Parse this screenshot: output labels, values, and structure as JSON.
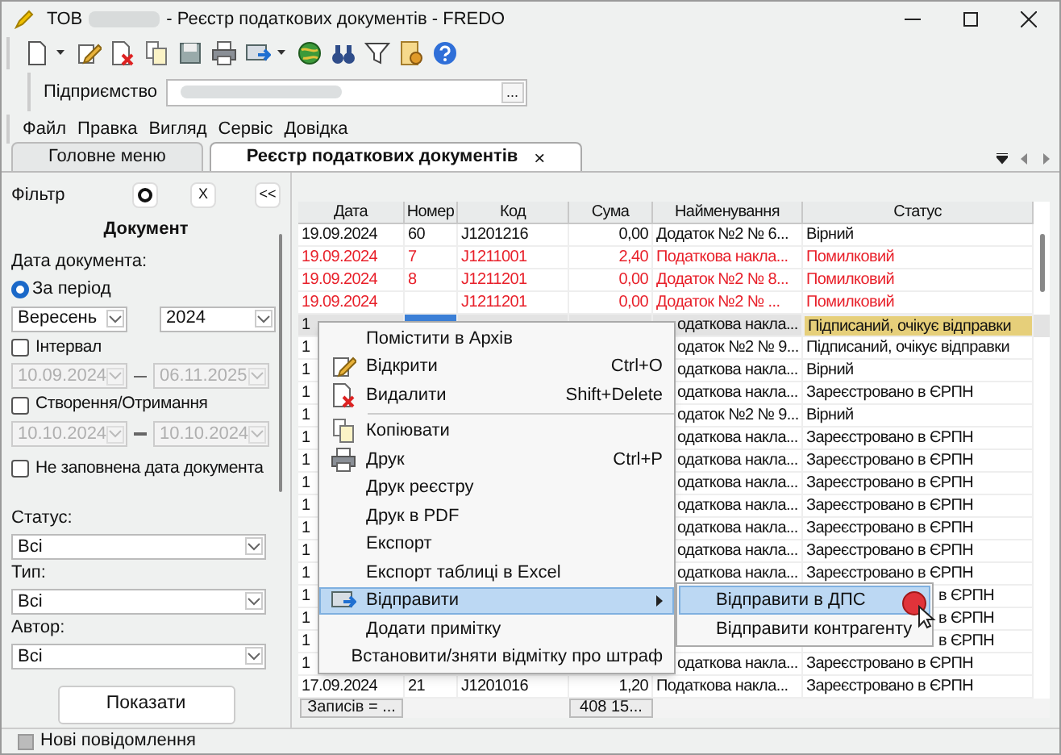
{
  "window": {
    "title_prefix": "ТОВ",
    "title": "- Реєстр податкових документів - FREDO"
  },
  "enterprise": {
    "label": "Підприємство",
    "browse": "..."
  },
  "menu_bar": [
    "Файл",
    "Правка",
    "Вигляд",
    "Сервіс",
    "Довідка"
  ],
  "tabs": [
    {
      "label": "Головне меню",
      "selected": false
    },
    {
      "label": "Реєстр податкових документів",
      "selected": true,
      "close": "×"
    }
  ],
  "filter": {
    "title": "Фільтр",
    "clear": "X",
    "collapse": "<<",
    "section": "Документ",
    "date_label": "Дата документа:",
    "period": {
      "label": "За період",
      "selected": true,
      "month": "Вересень",
      "year": "2024"
    },
    "interval": {
      "label": "Інтервал",
      "checked": false,
      "from": "10.09.2024",
      "to": "06.11.2025",
      "disabled": true
    },
    "created": {
      "label": "Створення/Отримання",
      "checked": false,
      "from": "10.10.2024",
      "to": "10.10.2024",
      "disabled": true
    },
    "empty_date": {
      "label": "Не заповнена дата документа",
      "checked": false
    },
    "selects": [
      {
        "label": "Статус:",
        "value": "Всі"
      },
      {
        "label": "Тип:",
        "value": "Всі"
      },
      {
        "label": "Автор:",
        "value": "Всі"
      }
    ],
    "show_button": "Показати"
  },
  "table": {
    "columns": [
      "Дата",
      "Номер",
      "Код",
      "Сума",
      "Найменування",
      "Статус"
    ],
    "rows": [
      {
        "kind": "normal",
        "selected": false,
        "date": "19.09.2024",
        "number": "60",
        "code": "J1201216",
        "sum": "0,00",
        "name": "Додаток №2 № 6...",
        "status": "Вірний"
      },
      {
        "kind": "error",
        "selected": false,
        "date": "19.09.2024",
        "number": "7",
        "code": "J1211001",
        "sum": "2,40",
        "name": "Податкова накла...",
        "status": "Помилковий"
      },
      {
        "kind": "error",
        "selected": false,
        "date": "19.09.2024",
        "number": "8",
        "code": "J1211201",
        "sum": "0,00",
        "name": "Додаток №2 № 8...",
        "status": "Помилковий"
      },
      {
        "kind": "error",
        "selected": false,
        "date": "19.09.2024",
        "number": "",
        "code": "J1211201",
        "sum": "0,00",
        "name": "Додаток №2 №   ...",
        "status": "Помилковий"
      },
      {
        "kind": "under_menu",
        "selected": true,
        "date": "1",
        "name": "одаткова накла...",
        "status": "Підписаний, очікує відправки"
      },
      {
        "kind": "under_menu",
        "selected": false,
        "date": "1",
        "name": "одаток №2 № 9...",
        "status": "Підписаний, очікує відправки"
      },
      {
        "kind": "under_menu",
        "selected": false,
        "date": "1",
        "name": "одаткова накла...",
        "status": "Вірний"
      },
      {
        "kind": "under_menu",
        "selected": false,
        "date": "1",
        "name": "одаткова накла...",
        "status": "Зареєстровано в ЄРПН"
      },
      {
        "kind": "under_menu",
        "selected": false,
        "date": "1",
        "name": "одаток №2 № 9...",
        "status": "Вірний"
      },
      {
        "kind": "under_menu",
        "selected": false,
        "date": "1",
        "name": "одаткова накла...",
        "status": "Зареєстровано в ЄРПН"
      },
      {
        "kind": "under_menu",
        "selected": false,
        "date": "1",
        "name": "одаткова накла...",
        "status": "Зареєстровано в ЄРПН"
      },
      {
        "kind": "under_menu",
        "selected": false,
        "date": "1",
        "name": "одаткова накла...",
        "status": "Зареєстровано в ЄРПН"
      },
      {
        "kind": "under_menu",
        "selected": false,
        "date": "1",
        "name": "одаткова накла...",
        "status": "Зареєстровано в ЄРПН"
      },
      {
        "kind": "under_menu",
        "selected": false,
        "date": "1",
        "name": "одаткова накла...",
        "status": "Зареєстровано в ЄРПН"
      },
      {
        "kind": "under_menu",
        "selected": false,
        "date": "1",
        "name": "одаткова накла...",
        "status": "Зареєстровано в ЄРПН"
      },
      {
        "kind": "under_menu",
        "selected": false,
        "date": "1",
        "name": "одаткова накла...",
        "status": "Зареєстровано в ЄРПН"
      },
      {
        "kind": "under_submenu",
        "selected": false,
        "date": "1",
        "status": "в ЄРПН"
      },
      {
        "kind": "under_submenu",
        "selected": false,
        "date": "1",
        "status": "в ЄРПН"
      },
      {
        "kind": "under_submenu",
        "selected": false,
        "date": "1",
        "status": "в ЄРПН"
      },
      {
        "kind": "under_menu",
        "selected": false,
        "date": "1",
        "name": "одаткова накла...",
        "status": "Зареєстровано в ЄРПН"
      },
      {
        "kind": "normal",
        "selected": false,
        "date": "17.09.2024",
        "number": "21",
        "code": "J1201016",
        "sum": "1,20",
        "name": "Податкова накла...",
        "status": "Зареєстровано в ЄРПН"
      }
    ],
    "footer": {
      "count": "Записів = ...",
      "total": "408 15..."
    }
  },
  "context_menu": [
    {
      "kind": "item",
      "label": "Помістити в Архів",
      "selected": false
    },
    {
      "kind": "item",
      "label": "Відкрити",
      "shortcut": "Ctrl+O",
      "selected": false
    },
    {
      "kind": "item",
      "label": "Видалити",
      "shortcut": "Shift+Delete",
      "selected": false
    },
    {
      "kind": "separator"
    },
    {
      "kind": "item",
      "label": "Копіювати",
      "selected": false
    },
    {
      "kind": "item",
      "label": "Друк",
      "shortcut": "Ctrl+P",
      "selected": false
    },
    {
      "kind": "item",
      "label": "Друк реєстру",
      "selected": false
    },
    {
      "kind": "item",
      "label": "Друк в PDF",
      "selected": false
    },
    {
      "kind": "item",
      "label": "Експорт",
      "selected": false
    },
    {
      "kind": "item",
      "label": "Експорт таблиці в Excel",
      "selected": false
    },
    {
      "kind": "submenu",
      "label": "Відправити",
      "selected": true
    },
    {
      "kind": "item",
      "label": "Додати примітку",
      "selected": false
    },
    {
      "kind": "item",
      "label": "Встановити/зняти відмітку про штраф",
      "selected": false
    }
  ],
  "submenu": [
    {
      "label": "Відправити в ДПС",
      "selected": true
    },
    {
      "label": "Відправити контрагенту",
      "selected": false
    }
  ],
  "status_bar": {
    "text": "Нові повідомлення"
  }
}
